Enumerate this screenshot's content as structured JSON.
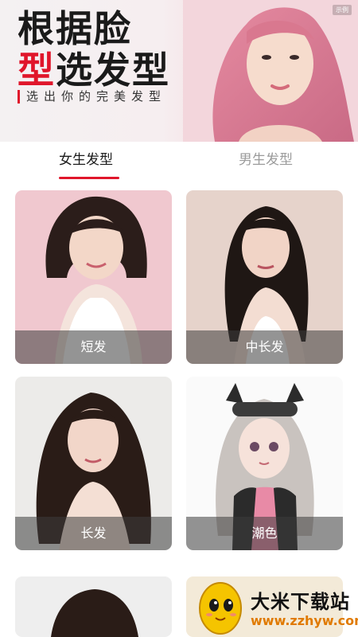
{
  "hero": {
    "title_line1": "根据脸",
    "title_line2_red": "型",
    "title_line2_rest": "选发型",
    "subtitle": "选出你的完美发型",
    "corner_tag": "示例"
  },
  "tabs": [
    {
      "label": "女生发型",
      "active": true
    },
    {
      "label": "男生发型",
      "active": false
    }
  ],
  "cards": [
    {
      "label": "短发"
    },
    {
      "label": "中长发"
    },
    {
      "label": "长发"
    },
    {
      "label": "潮色"
    }
  ],
  "watermark": {
    "name": "大米下载站",
    "url": "www.zzhyw.com"
  },
  "colors": {
    "accent": "#e0162b",
    "watermark_url": "#e07a00"
  }
}
